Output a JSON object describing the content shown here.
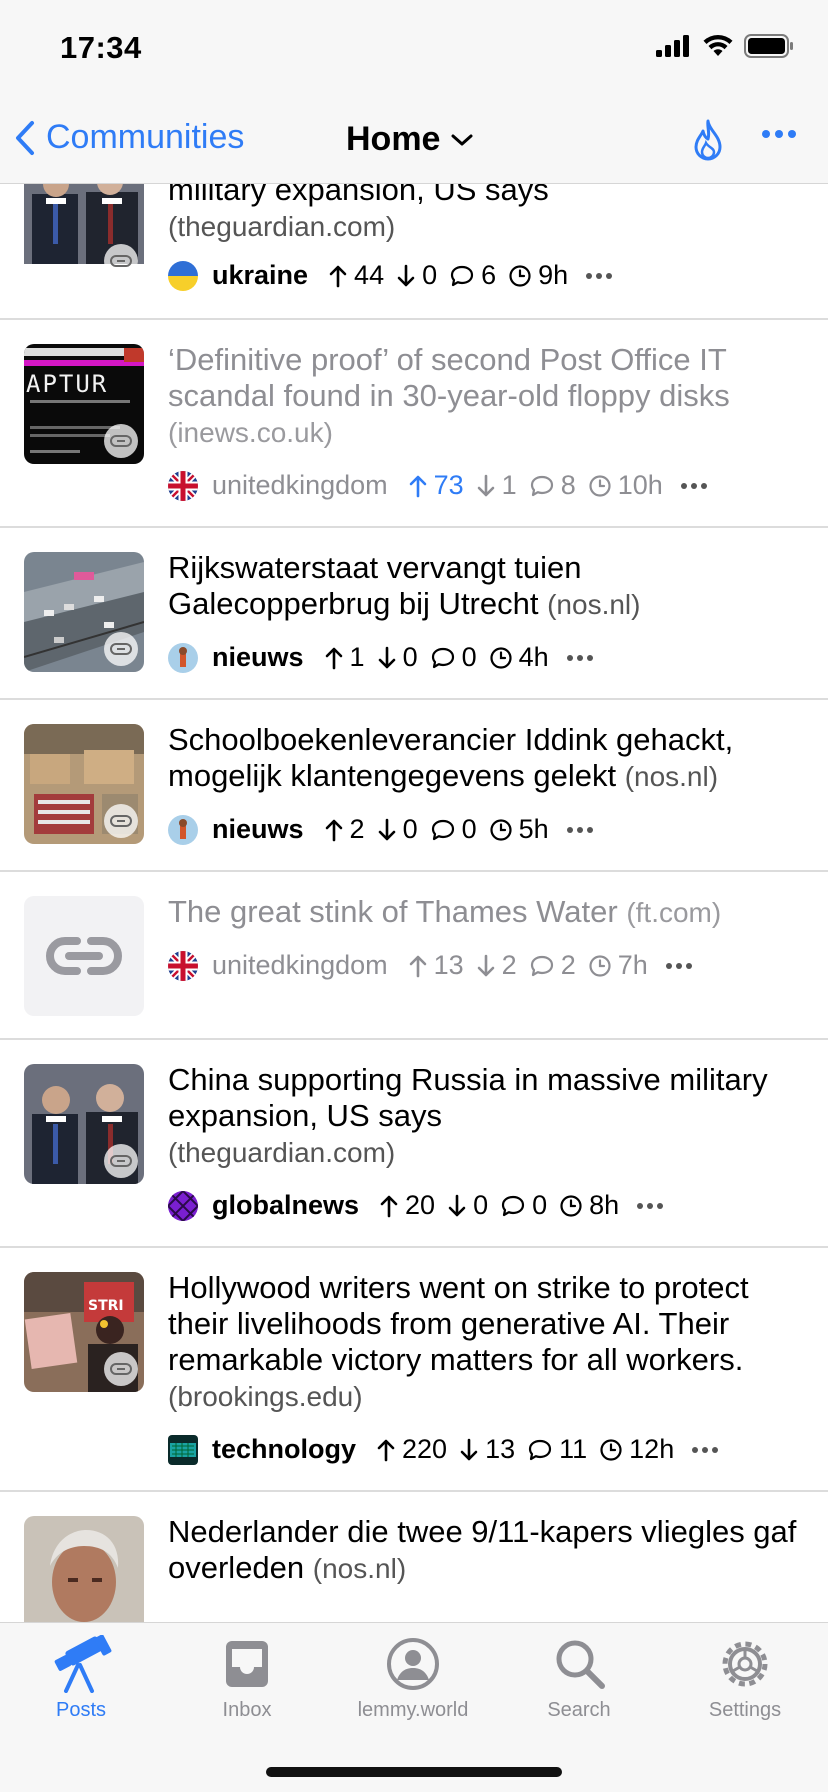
{
  "status": {
    "time": "17:34"
  },
  "nav": {
    "back_label": "Communities",
    "title": "Home"
  },
  "posts": [
    {
      "title": "military expansion, US says",
      "domain": "(theguardian.com)",
      "community": "ukraine",
      "up": "44",
      "down": "0",
      "comments": "6",
      "age": "9h"
    },
    {
      "title": "‘Definitive proof’ of second Post Office IT scandal found in 30-year-old floppy disks",
      "domain": "(inews.co.uk)",
      "community": "unitedkingdom",
      "up": "73",
      "down": "1",
      "comments": "8",
      "age": "10h"
    },
    {
      "title": "Rijkswaterstaat vervangt tuien Galecopperbrug bij Utrecht",
      "domain": "(nos.nl)",
      "community": "nieuws",
      "up": "1",
      "down": "0",
      "comments": "0",
      "age": "4h"
    },
    {
      "title": "Schoolboekenleverancier Iddink gehackt, mogelijk klantengegevens gelekt",
      "domain": "(nos.nl)",
      "community": "nieuws",
      "up": "2",
      "down": "0",
      "comments": "0",
      "age": "5h"
    },
    {
      "title": "The great stink of Thames Water",
      "domain": "(ft.com)",
      "community": "unitedkingdom",
      "up": "13",
      "down": "2",
      "comments": "2",
      "age": "7h"
    },
    {
      "title": "China supporting Russia in massive military expansion, US says",
      "domain": "(theguardian.com)",
      "community": "globalnews",
      "up": "20",
      "down": "0",
      "comments": "0",
      "age": "8h"
    },
    {
      "title": "Hollywood writers went on strike to protect their livelihoods from generative AI. Their remarkable victory matters for all workers.",
      "domain": "(brookings.edu)",
      "community": "technology",
      "up": "220",
      "down": "13",
      "comments": "11",
      "age": "12h"
    },
    {
      "title": "Nederlander die twee 9/11-kapers vliegles gaf overleden",
      "domain": "(nos.nl)"
    }
  ],
  "tabs": [
    {
      "label": "Posts",
      "icon": "telescope-icon",
      "active": true
    },
    {
      "label": "Inbox",
      "icon": "inbox-tray-icon"
    },
    {
      "label": "lemmy.world",
      "icon": "person-circle-icon"
    },
    {
      "label": "Search",
      "icon": "magnifying-glass-icon"
    },
    {
      "label": "Settings",
      "icon": "gear-icon"
    }
  ],
  "colors": {
    "accent": "#2f7cf6",
    "muted": "#8e8e93",
    "divider": "#dcdcdc"
  }
}
